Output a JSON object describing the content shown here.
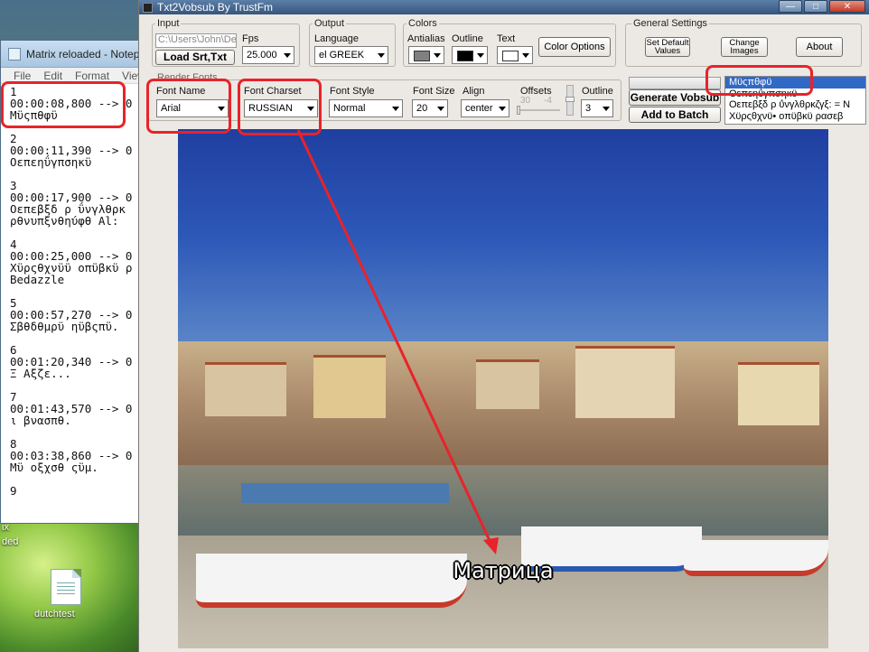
{
  "desktop": {
    "edge_text_1": "ix",
    "edge_text_2": "ded",
    "icon_label": "dutchtest"
  },
  "notepad": {
    "title": "Matrix reloaded - Notep",
    "menu": [
      "File",
      "Edit",
      "Format",
      "View"
    ],
    "entries": [
      {
        "num": "1",
        "time": "00:00:08,800 --> 0",
        "text": "Μϋςπθφϋ"
      },
      {
        "num": "2",
        "time": "00:00:11,390 --> 0",
        "text": "Οεπεηΰγπσηκϋ"
      },
      {
        "num": "3",
        "time": "00:00:17,900 --> 0",
        "text": "Οεπεβξδ ρ ΰνγλθρκ\nρθνυπξνθηύφθ Al:"
      },
      {
        "num": "4",
        "time": "00:00:25,000 --> 0",
        "text": "Χϋρςθχνϋϋ οπϋβκϋ ρ\nBedazzle"
      },
      {
        "num": "5",
        "time": "00:00:57,270 --> 0",
        "text": "Σβθδθμρϋ ηϋβςπϋ."
      },
      {
        "num": "6",
        "time": "00:01:20,340 --> 0",
        "text": "Ξ Αξζε..."
      },
      {
        "num": "7",
        "time": "00:01:43,570 --> 0",
        "text": "ι βνασπθ."
      },
      {
        "num": "8",
        "time": "00:03:38,860 --> 0",
        "text": "Μϋ οξχσθ ςϋμ."
      },
      {
        "num": "9",
        "time": "",
        "text": ""
      }
    ]
  },
  "app": {
    "title": "Txt2Vobsub By TrustFm",
    "input": {
      "group_title": "Input",
      "path_value": "C:\\Users\\John\\De",
      "load_button": "Load Srt,Txt",
      "fps_label": "Fps",
      "fps_value": "25.000"
    },
    "output": {
      "group_title": "Output",
      "language_label": "Language",
      "language_value": "el GREEK"
    },
    "colors": {
      "group_title": "Colors",
      "antialias_label": "Antialias",
      "outline_label": "Outline",
      "text_label": "Text",
      "antialias_color": "#808080",
      "outline_color": "#000000",
      "text_color": "#ffffff",
      "color_options_button": "Color Options"
    },
    "general": {
      "group_title": "General Settings",
      "set_default_button": "Set Default\nValues",
      "change_images_button": "Change\nImages",
      "about_button": "About"
    },
    "render": {
      "group_title": "Render Fonts",
      "font_name_label": "Font Name",
      "font_name_value": "Arial",
      "font_charset_label": "Font Charset",
      "font_charset_value": "RUSSIAN",
      "font_style_label": "Font Style",
      "font_style_value": "Normal",
      "font_size_label": "Font Size",
      "font_size_value": "20",
      "align_label": "Align",
      "align_value": "center",
      "offsets_label": "Offsets",
      "offset_x": "30",
      "offset_y": "-4",
      "outline_label": "Outline",
      "outline_value": "3"
    },
    "actions": {
      "generate_button": "Generate Vobsub",
      "add_batch_button": "Add to Batch"
    },
    "subtitle_list": [
      "Μϋςπθφϋ",
      "Οεπεηΰγπσηκϋ",
      "Οεπεβξδ ρ ΰνγλθρκζγξ: = Ν",
      "Χϋρςθχνϋ• οπϋβκϋ ρασεβ"
    ],
    "preview_subtitle": "Матрица",
    "highlight_color": "#e8232a"
  }
}
